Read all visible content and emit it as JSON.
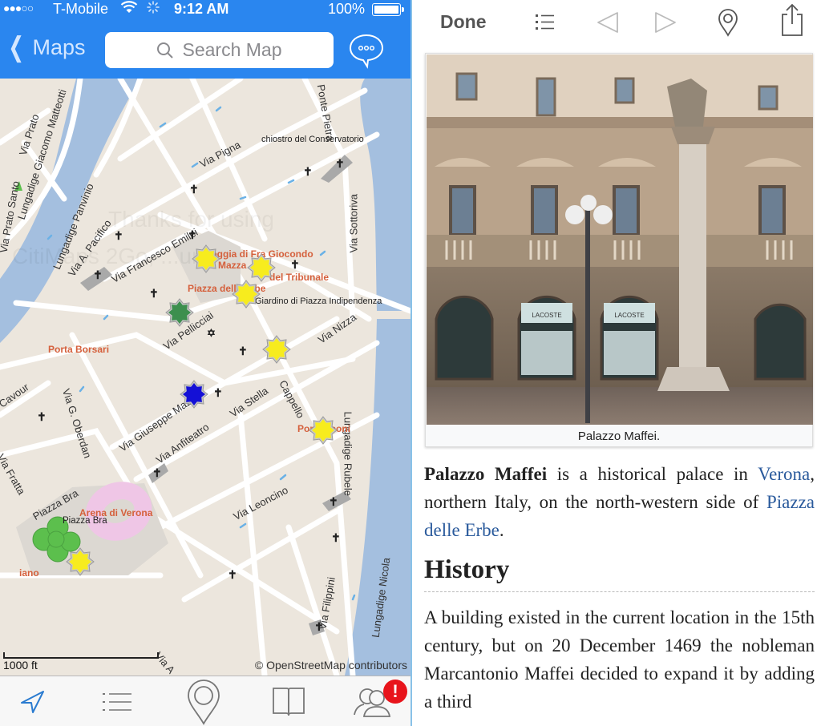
{
  "status_bar": {
    "signal": "●●●○○",
    "carrier": "T-Mobile",
    "time": "9:12 AM",
    "battery": "100%"
  },
  "map_nav": {
    "back_label": "Maps",
    "search_placeholder": "Search Map",
    "chat_icon": "speech-bubble-ellipsis-icon"
  },
  "map": {
    "street_labels": [
      "Via Prato",
      "Lungadige Giacomo Matteotti",
      "Via Prato Santo",
      "Lungadige Panvinio",
      "Via A. Pacifico",
      "Via Francesco Emilei",
      "Via Pigna",
      "Ponte Pietra",
      "Via Sottoriva",
      "Via Pellicciai",
      "Via Nizza",
      "Via G. Oberdan",
      "Via Giuseppe Mazzini",
      "Via Stella",
      "Cappello",
      "Via Anfiteatro",
      "Via Leoncino",
      "Lungadige Rubele",
      "Piazza Bra",
      "Via Filippini",
      "Lungadige Nicola",
      "Via Fratta",
      "Cavour",
      "Via A"
    ],
    "poi_labels": [
      "chiostro del Conservatorio",
      "Loggia di Fra Giocondo",
      "Mazza",
      "del Tribunale",
      "Piazza delle Erbe",
      "Giardino di Piazza Indipendenza",
      "Porta Borsari",
      "Porta Leoni",
      "Arena di Verona",
      "Piazza Bra",
      "iano"
    ],
    "watermark": "Thanks for using CitiMaps 2Go, ...ur",
    "scale_label": "1000 ft",
    "attribution": "© OpenStreetMap contributors",
    "marker_colors": {
      "yellow": "#f7ec1e",
      "green": "#3d8f4e",
      "blue": "#1410d6"
    }
  },
  "tabbar": {
    "items": [
      {
        "name": "location-arrow-icon",
        "active": true
      },
      {
        "name": "list-icon"
      },
      {
        "name": "map-pin-icon"
      },
      {
        "name": "book-icon"
      },
      {
        "name": "people-icon"
      }
    ],
    "badge": "!"
  },
  "article_toolbar": {
    "done_label": "Done",
    "icons": [
      "toc-list-icon",
      "back-arrow-icon",
      "forward-arrow-icon",
      "map-pin-icon",
      "share-icon"
    ]
  },
  "article": {
    "caption": "Palazzo Maffei.",
    "intro": {
      "bold": "Palazzo Maffei",
      "text1": " is a historical palace in ",
      "link1": "Verona",
      "text2": ", northern Italy, on the north-western side of ",
      "link2": "Piazza delle Erbe",
      "text3": "."
    },
    "section_title": "History",
    "section_text": "A building existed in the current location in the 15th century, but on 20 December 1469 the nobleman Marcantonio Maffei decided to expand it by adding a third",
    "photo_signs": [
      "LACOSTE",
      "LACOSTE"
    ]
  },
  "colors": {
    "nav_blue": "#2a86ef",
    "link_blue": "#2a5a9c",
    "water": "#a4bfdf",
    "land": "#ece6dd",
    "badge_red": "#e8141b"
  }
}
